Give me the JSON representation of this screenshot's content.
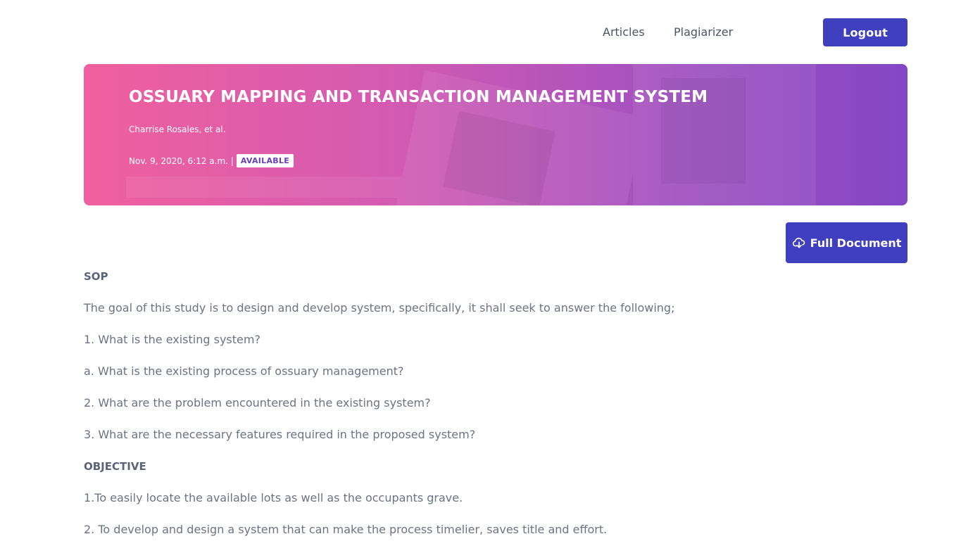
{
  "nav": {
    "articles_label": "Articles",
    "plagiarizer_label": "Plagiarizer",
    "logout_label": "Logout"
  },
  "hero": {
    "title": "OSSUARY MAPPING AND TRANSACTION MANAGEMENT SYSTEM",
    "author": "Charrise Rosales, et al.",
    "date": "Nov. 9, 2020, 6:12 a.m. |",
    "status_badge": "AVAILABLE"
  },
  "actions": {
    "full_document_label": "Full Document",
    "full_document_icon": "cloud-download-icon"
  },
  "content": {
    "sop_heading": "SOP",
    "sop_items": [
      "The goal of this study is to design and develop system, specifically, it shall seek to answer the following;",
      "1. What is the existing system?",
      "a. What is the existing process of ossuary management?",
      "2. What are the problem encountered in the existing system?",
      "3. What are the necessary features required in the proposed system?"
    ],
    "objective_heading": "OBJECTIVE",
    "objective_items": [
      "1.To easily locate the available lots as well as the occupants grave.",
      "2. To develop and design a system that can make the process timelier, saves title and effort."
    ]
  },
  "colors": {
    "primary": "#3f3fc0",
    "hero_gradient_start": "#f0609e",
    "hero_gradient_end": "#8447c4",
    "badge_text": "#6b3fb8"
  }
}
